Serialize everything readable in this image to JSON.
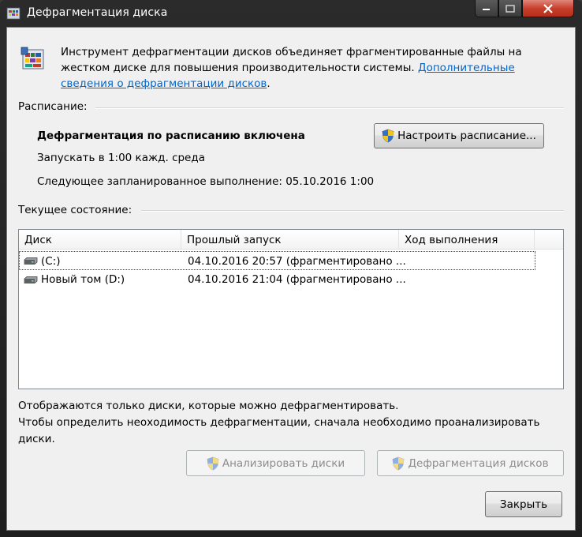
{
  "window": {
    "title": "Дефрагментация диска"
  },
  "intro": {
    "text": "Инструмент дефрагментации дисков объединяет фрагментированные файлы на жестком диске для повышения производительности системы. ",
    "link": "Дополнительные сведения о дефрагментации дисков",
    "after": "."
  },
  "schedule": {
    "label": "Расписание:",
    "status": "Дефрагментация по расписанию включена",
    "run": "Запускать в 1:00 кажд. среда",
    "next": "Следующее запланированное выполнение: 05.10.2016 1:00",
    "configure_button": "Настроить расписание..."
  },
  "current": {
    "label": "Текущее состояние:",
    "columns": [
      "Диск",
      "Прошлый запуск",
      "Ход выполнения"
    ],
    "rows": [
      {
        "disk": "(C:)",
        "last_run": "04.10.2016 20:57 (фрагментировано ...",
        "progress": ""
      },
      {
        "disk": "Новый том (D:)",
        "last_run": "04.10.2016 21:04 (фрагментировано ...",
        "progress": ""
      }
    ]
  },
  "notes": {
    "line1": "Отображаются только диски, которые можно дефрагментировать.",
    "line2": "Чтобы определить неоходимость  дефрагментации, сначала необходимо проанализировать диски."
  },
  "buttons": {
    "analyze": "Анализировать диски",
    "defrag": "Дефрагментация дисков",
    "close": "Закрыть"
  },
  "icons": {
    "app": "defrag-icon",
    "shield": "uac-shield-icon",
    "drive": "hard-drive-icon"
  }
}
